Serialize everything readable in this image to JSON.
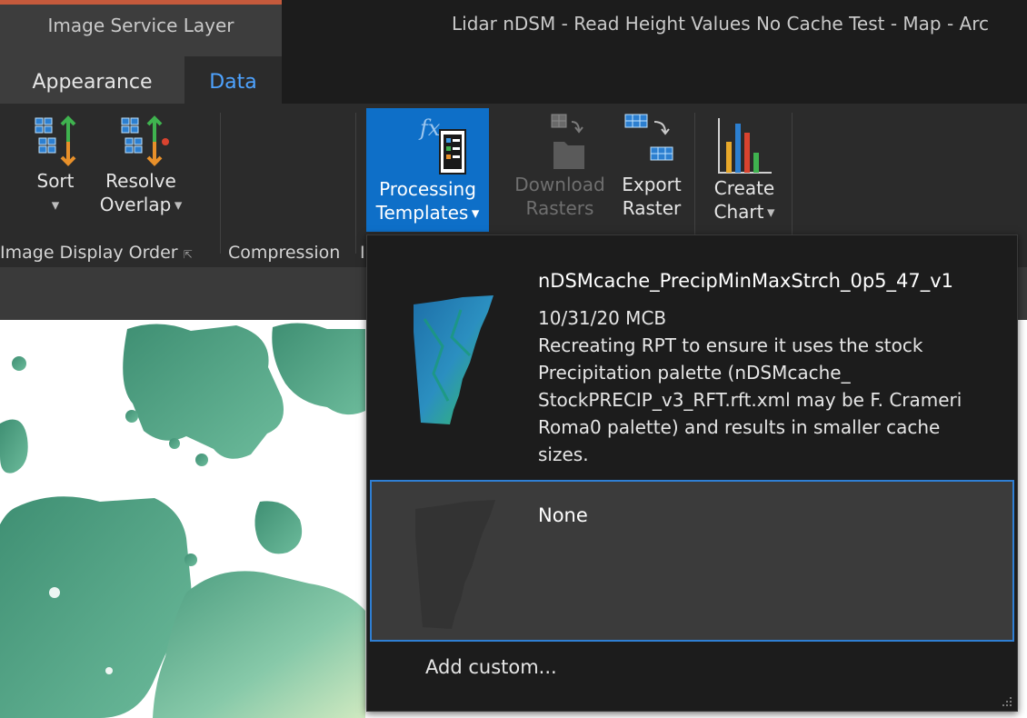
{
  "title_bar": {
    "context_group": "Image Service Layer",
    "window_title": "Lidar nDSM - Read Height Values No Cache Test - Map - Arc"
  },
  "tabs": [
    {
      "label": "Appearance",
      "active": false
    },
    {
      "label": "Data",
      "active": true
    }
  ],
  "ribbon": {
    "sort_label": "Sort",
    "resolve_label": "Resolve",
    "overlap_label": "Overlap",
    "processing_label": "Processing",
    "templates_label": "Templates",
    "download_label": "Download",
    "rasters_label": "Rasters",
    "export_label": "Export",
    "raster_label": "Raster",
    "create_label": "Create",
    "chart_label": "Chart",
    "group_image_display_order": "Image Display Order",
    "group_compression": "Compression",
    "group_partial": "I",
    "fx_glyph": "fx"
  },
  "dropdown": {
    "items": [
      {
        "title": "nDSMcache_PrecipMinMaxStrch_0p5_47_v1",
        "description": "10/31/20 MCB\nRecreating RPT to ensure it uses the stock\nPrecipitation palette (nDSMcache_\nStockPRECIP_v3_RFT.rft.xml may be F. Crameri\nRoma0 palette) and results in smaller cache\nsizes."
      },
      {
        "title": "None",
        "selected": true
      }
    ],
    "add_custom": "Add custom..."
  },
  "colors": {
    "accent_blue": "#0e6fc8",
    "tab_active_text": "#4ea3ff",
    "context_strip": "#c55a3c",
    "selection_border": "#2f7fd4",
    "map_green": "#4fa88a"
  }
}
